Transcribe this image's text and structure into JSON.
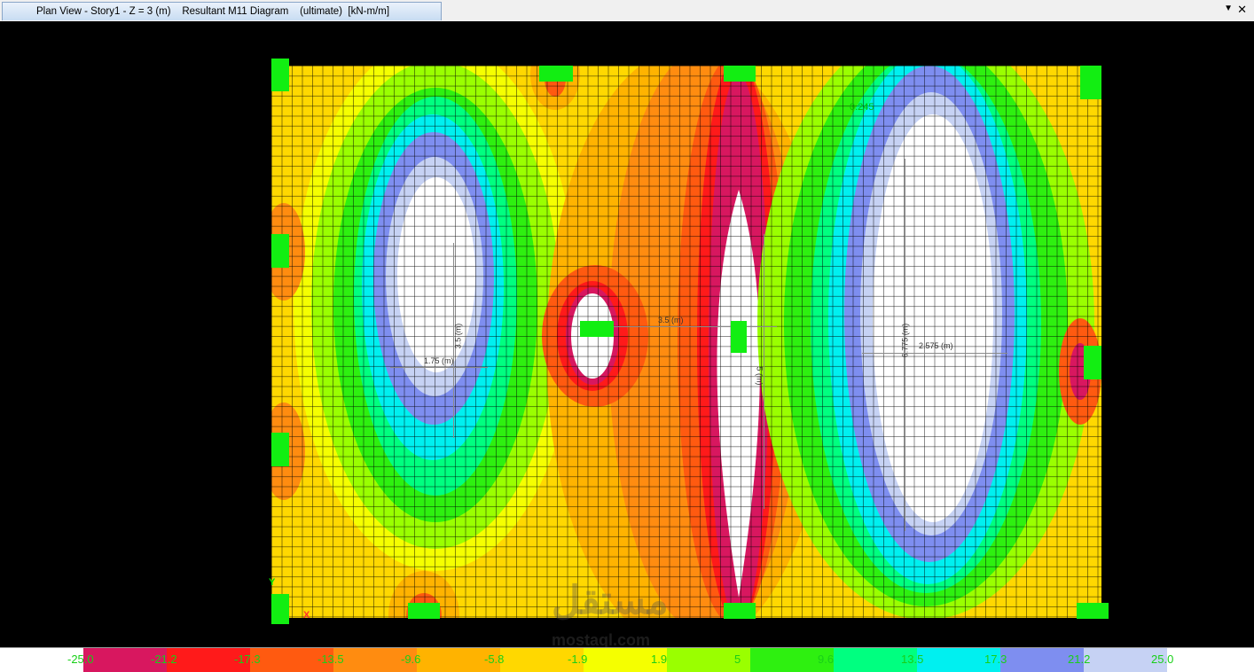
{
  "window": {
    "title": "Plan View - Story1 - Z = 3 (m)    Resultant M11 Diagram    (ultimate)  [kN-m/m]",
    "menu_glyph": "▼",
    "close_glyph": "✕"
  },
  "dimensions": {
    "d1": "3.5 (m)",
    "d2": "1.75 (m)",
    "d3": "3.5 (m)",
    "d4": "5 (m)",
    "d5": "6.775 (m)",
    "d6": "2.575 (m)",
    "top": "0.245"
  },
  "axes": {
    "y": "Y",
    "x": "X"
  },
  "legend": {
    "labels": [
      "-25.0",
      "-21.2",
      "-17.3",
      "-13.5",
      "-9.6",
      "-5.8",
      "-1.9",
      "1.9",
      "5",
      "9.6",
      "13.5",
      "17.3",
      "21.2",
      "25.0"
    ],
    "colors": [
      "#ffffff",
      "#d8175f",
      "#ff1a1a",
      "#ff5a10",
      "#ff8c10",
      "#ffb300",
      "#ffd800",
      "#f5ff00",
      "#9aff00",
      "#2ef010",
      "#00ff80",
      "#00f0f0",
      "#7e8ef0",
      "#c6d2f4",
      "#ffffff"
    ]
  },
  "watermark": {
    "main": "مستقل",
    "sub": "mostaql.com"
  }
}
